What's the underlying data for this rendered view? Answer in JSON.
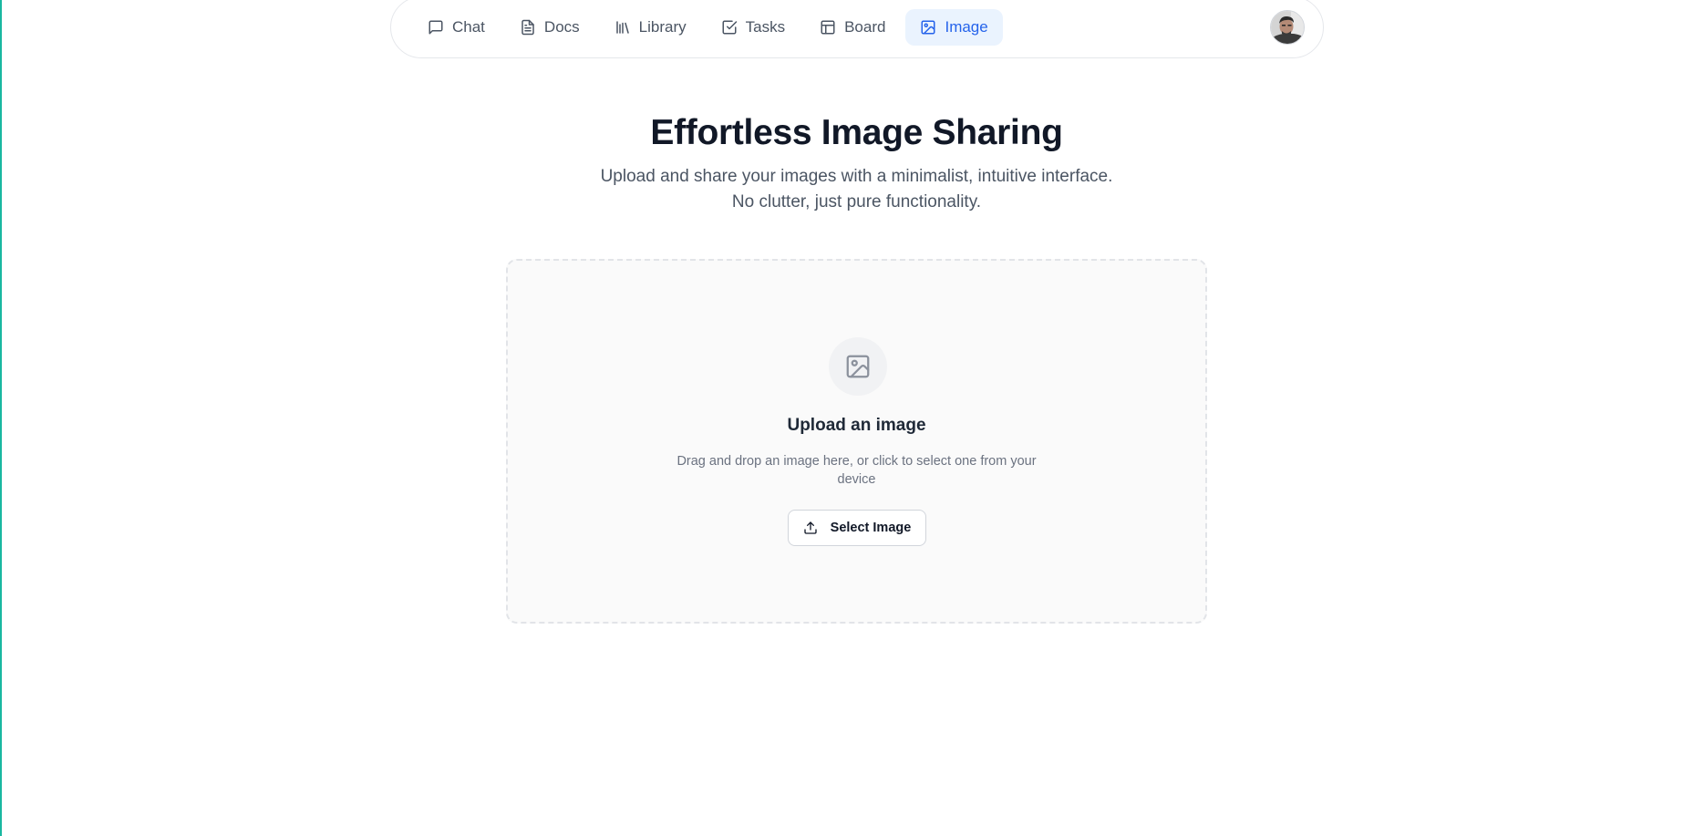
{
  "nav": {
    "items": [
      {
        "label": "Chat",
        "icon": "message-square-icon",
        "active": false
      },
      {
        "label": "Docs",
        "icon": "file-text-icon",
        "active": false
      },
      {
        "label": "Library",
        "icon": "library-icon",
        "active": false
      },
      {
        "label": "Tasks",
        "icon": "check-square-icon",
        "active": false
      },
      {
        "label": "Board",
        "icon": "layout-board-icon",
        "active": false
      },
      {
        "label": "Image",
        "icon": "image-icon",
        "active": true
      }
    ],
    "avatar_icon": "user-avatar"
  },
  "hero": {
    "title": "Effortless Image Sharing",
    "subtitle_line1": "Upload and share your images with a minimalist, intuitive interface.",
    "subtitle_line2": "No clutter, just pure functionality."
  },
  "upload": {
    "icon": "image-icon",
    "title": "Upload an image",
    "description": "Drag and drop an image here, or click to select one from your device",
    "button_label": "Select Image",
    "button_icon": "upload-icon"
  },
  "colors": {
    "accent": "#2563eb",
    "active_bg": "#eaf3fe",
    "text_dark": "#111827",
    "text_muted": "#6b7280",
    "edge_line": "#19b7a0"
  }
}
